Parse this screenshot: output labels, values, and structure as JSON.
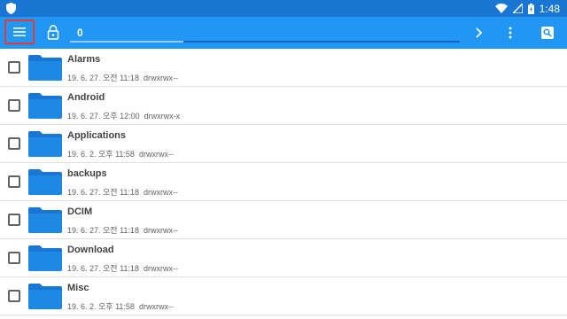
{
  "status_bar": {
    "time": "1:48",
    "icons": [
      "shield-icon",
      "wifi-icon",
      "signal-icon",
      "battery-icon"
    ]
  },
  "toolbar": {
    "menu_icon": "hamburger-menu-icon",
    "lock_icon": "lock-icon",
    "selected_count": "0",
    "progress_fraction": 0.29,
    "forward_icon": "chevron-right-icon",
    "more_icon": "more-vert-icon",
    "search_icon": "search-icon"
  },
  "files": [
    {
      "name": "Alarms",
      "date": "19. 6. 27. 오전 11:18",
      "perm": "drwxrwx--"
    },
    {
      "name": "Android",
      "date": "19. 6. 27. 오후 12:00",
      "perm": "drwxrwx-x"
    },
    {
      "name": "Applications",
      "date": "19. 6. 2. 오후 11:58",
      "perm": "drwxrwx--"
    },
    {
      "name": "backups",
      "date": "19. 6. 27. 오전 11:18",
      "perm": "drwxrwx--"
    },
    {
      "name": "DCIM",
      "date": "19. 6. 27. 오전 11:18",
      "perm": "drwxrwx--"
    },
    {
      "name": "Download",
      "date": "19. 6. 27. 오전 11:18",
      "perm": "drwxrwx--"
    },
    {
      "name": "Misc",
      "date": "19. 6. 2. 오후 11:58",
      "perm": "drwxrwx--"
    }
  ],
  "colors": {
    "status_bar": "#1976d2",
    "toolbar": "#2196f3",
    "folder": "#1976d2",
    "highlight": "#e53935"
  }
}
